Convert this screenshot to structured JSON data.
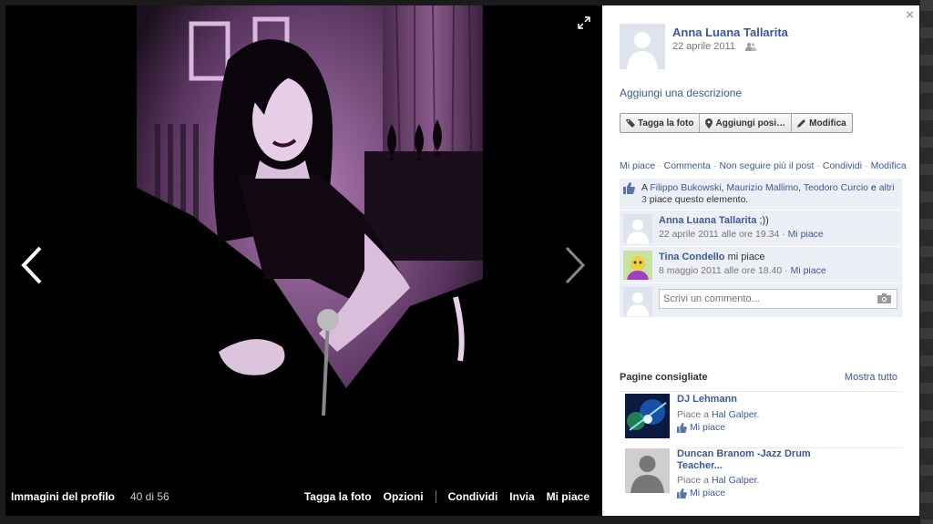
{
  "viewer": {
    "album_title": "Immagini del profilo",
    "photo_count": "40 di 56",
    "actions": [
      "Tagga la foto",
      "Opzioni",
      "Condividi",
      "Invia",
      "Mi piace"
    ]
  },
  "panel": {
    "owner_name": "Anna Luana Tallarita",
    "date": "22 aprile 2011",
    "add_description": "Aggiungi una descrizione",
    "buttons": [
      "Tagga la foto",
      "Aggiungi posi…",
      "Modifica"
    ],
    "links": [
      "Mi piace",
      "Commenta",
      "Non seguire più il post",
      "Condividi",
      "Modifica"
    ],
    "likes": {
      "prefix": "A ",
      "names": [
        "Filippo Bukowski",
        "Maurizio Mallimo",
        "Teodoro Curcio"
      ],
      "sep1": ", ",
      "sep2": ", ",
      "and": " e ",
      "others": "altri 3",
      "suffix": "piace questo elemento."
    },
    "comments": [
      {
        "name": "Anna Luana Tallarita",
        "text": ";))",
        "time": "22 aprile 2011 alle ore 19.34",
        "like": "Mi piace"
      },
      {
        "name": "Tina Condello",
        "text": "mi piace",
        "time": "8 maggio 2011 alle ore 18.40",
        "like": "Mi piace"
      }
    ],
    "comment_placeholder": "Scrivi un commento...",
    "suggestions": {
      "title": "Pagine consigliate",
      "show_all": "Mostra tutto",
      "items": [
        {
          "name": "DJ Lehmann",
          "liked_by_prefix": "Piace a",
          "liked_by": "Hal Galper.",
          "like": "Mi piace"
        },
        {
          "name": "Duncan Branom -Jazz Drum Teacher...",
          "liked_by_prefix": "Piace a",
          "liked_by": "Hal Galper.",
          "like": "Mi piace"
        }
      ]
    }
  },
  "colors": {
    "link": "#3b5998",
    "panel_bg": "#ffffff",
    "feed_bg": "#eceff5",
    "photo_tint": "#c890c8"
  }
}
